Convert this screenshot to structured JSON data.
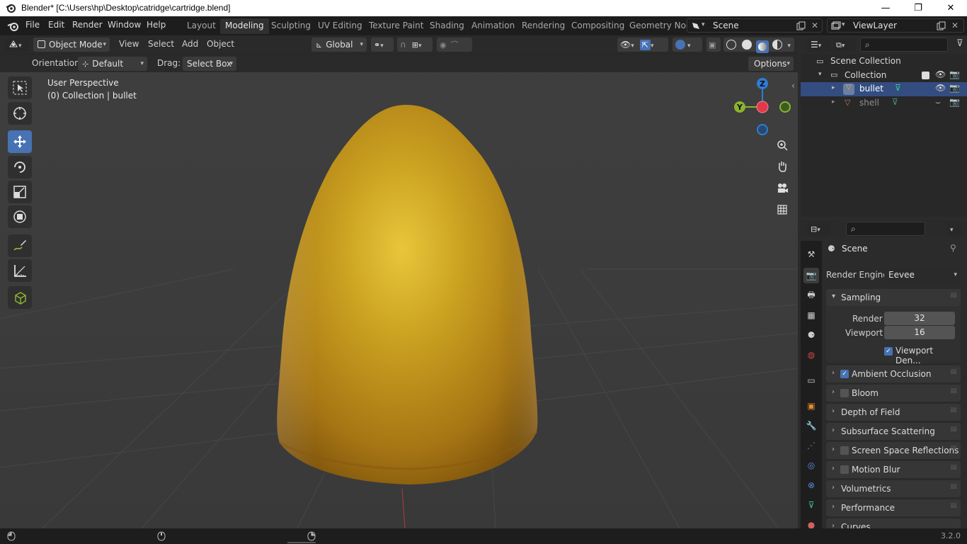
{
  "window": {
    "title": "Blender* [C:\\Users\\hp\\Desktop\\catridge\\cartridge.blend]",
    "minimize": "—",
    "restore": "❐",
    "close": "✕"
  },
  "menus": [
    "File",
    "Edit",
    "Render",
    "Window",
    "Help"
  ],
  "workspaces": [
    {
      "label": "Layout",
      "active": false
    },
    {
      "label": "Modeling",
      "active": true
    },
    {
      "label": "Sculpting",
      "active": false
    },
    {
      "label": "UV Editing",
      "active": false
    },
    {
      "label": "Texture Paint",
      "active": false
    },
    {
      "label": "Shading",
      "active": false
    },
    {
      "label": "Animation",
      "active": false
    },
    {
      "label": "Rendering",
      "active": false
    },
    {
      "label": "Compositing",
      "active": false
    },
    {
      "label": "Geometry Noc",
      "active": false
    }
  ],
  "scene_field": "Scene",
  "viewlayer_field": "ViewLayer",
  "viewport_header": {
    "mode": "Object Mode",
    "menus": [
      "View",
      "Select",
      "Add",
      "Object"
    ],
    "transform_orientation": "Global"
  },
  "tool_settings": {
    "orientation_label": "Orientation:",
    "orientation_value": "Default",
    "drag_label": "Drag:",
    "drag_value": "Select Box",
    "options": "Options"
  },
  "viewport": {
    "perspective": "User Perspective",
    "collection_info": "(0) Collection | bullet",
    "gizmo": {
      "x": "X",
      "y": "Y",
      "z": "Z"
    }
  },
  "outliner": {
    "root": "Scene Collection",
    "collection": "Collection",
    "objects": [
      {
        "name": "bullet",
        "selected": true
      },
      {
        "name": "shell",
        "selected": false
      }
    ]
  },
  "properties": {
    "title": "Scene",
    "render_engine_label": "Render Engine",
    "render_engine_value": "Eevee",
    "sampling": {
      "label": "Sampling",
      "render_label": "Render",
      "render_value": "32",
      "viewport_label": "Viewport",
      "viewport_value": "16",
      "denoise_label": "Viewport Den..."
    },
    "panels": [
      {
        "label": "Ambient Occlusion",
        "checkbox": true,
        "checked": true
      },
      {
        "label": "Bloom",
        "checkbox": true,
        "checked": false
      },
      {
        "label": "Depth of Field",
        "checkbox": false,
        "checked": false
      },
      {
        "label": "Subsurface Scattering",
        "checkbox": false,
        "checked": false
      },
      {
        "label": "Screen Space Reflections",
        "checkbox": true,
        "checked": false
      },
      {
        "label": "Motion Blur",
        "checkbox": true,
        "checked": false
      },
      {
        "label": "Volumetrics",
        "checkbox": false,
        "checked": false
      },
      {
        "label": "Performance",
        "checkbox": false,
        "checked": false
      },
      {
        "label": "Curves",
        "checkbox": false,
        "checked": false
      }
    ]
  },
  "status": {
    "version": "3.2.0"
  },
  "colors": {
    "accent": "#4772b3",
    "axis_x": "#e0394b",
    "axis_y": "#8ab42e",
    "axis_z": "#2f7cd6",
    "bullet_gold": "#c9a020"
  }
}
